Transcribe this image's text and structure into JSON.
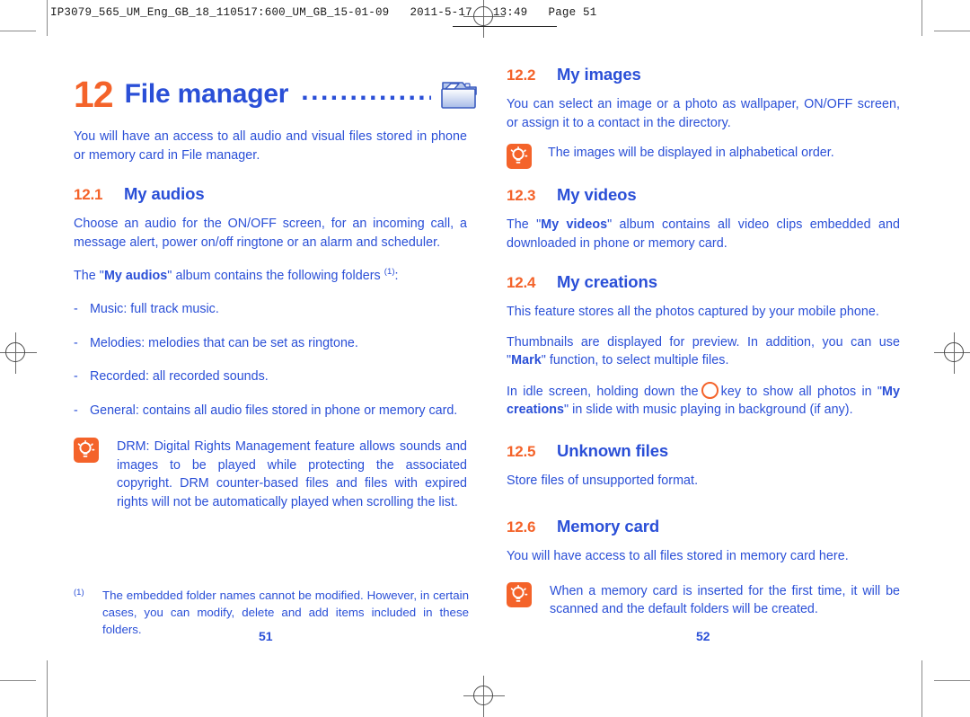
{
  "slug": {
    "text": "IP3079_565_UM_Eng_GB_18_110517:600_UM_GB_15-01-09   2011-5-17   13:49   Page 51"
  },
  "colors": {
    "heading_blue": "#2a4fd7",
    "accent_orange": "#f4632a",
    "body_blue": "#2a4fd7"
  },
  "chapter": {
    "number": "12",
    "name": "File manager",
    "dots": "................",
    "icon": "folder-icon"
  },
  "left_column": {
    "intro": "You will have an access to all audio and visual files stored in phone or memory card in File manager.",
    "sections": [
      {
        "number": "12.1",
        "title": "My audios",
        "paragraphs": [
          "Choose an audio for the ON/OFF screen, for an incoming call, a message alert, power on/off ringtone or an alarm and scheduler."
        ],
        "folders_intro_pre": "The \"",
        "folders_intro_bold": "My audios",
        "folders_intro_post": "\" album contains the following folders ",
        "folders_intro_sup": "(1)",
        "folders_intro_end": ":",
        "bullets": [
          {
            "dash": "-",
            "text": "Music: full track music."
          },
          {
            "dash": "-",
            "text": "Melodies: melodies that can be set as ringtone."
          },
          {
            "dash": "-",
            "text": "Recorded: all recorded sounds."
          },
          {
            "dash": "-",
            "text": "General: contains all audio files stored in phone or memory card."
          }
        ],
        "tip": {
          "icon": "tip-lightbulb-icon",
          "text": "DRM: Digital Rights Management feature allows sounds and images to be played while protecting the associated copyright. DRM counter-based files and files with expired rights will not be automatically played when scrolling the list."
        }
      }
    ]
  },
  "right_column": {
    "sections": [
      {
        "number": "12.2",
        "title": "My images",
        "paragraphs": [
          "You can select an image or a photo as wallpaper, ON/OFF screen, or assign it to a contact in the directory."
        ],
        "tip": {
          "icon": "tip-lightbulb-icon",
          "text": "The images will be displayed in alphabetical order."
        }
      },
      {
        "number": "12.3",
        "title": "My videos",
        "video_pre": "The \"",
        "video_bold": "My videos",
        "video_post": "\" album contains all video clips embedded and downloaded in phone or memory card."
      },
      {
        "number": "12.4",
        "title": "My creations",
        "p1": "This feature stores all the photos captured by your mobile phone.",
        "p2_pre": "Thumbnails are displayed for preview. In addition, you can use \"",
        "p2_bold": "Mark",
        "p2_post": "\" function, to select multiple files.",
        "p3_pre": "In idle screen, holding down the",
        "p3_key_icon": "round-key-icon",
        "p3_mid": "key to show all photos in \"",
        "p3_bold": "My creations",
        "p3_post": "\" in slide with music playing in background (if any)."
      },
      {
        "number": "12.5",
        "title": "Unknown files",
        "paragraphs": [
          "Store files of unsupported format."
        ]
      },
      {
        "number": "12.6",
        "title": "Memory card",
        "paragraphs": [
          "You will have access to all files stored in memory card here."
        ],
        "tip": {
          "icon": "tip-lightbulb-icon",
          "text": "When a memory card is inserted for the first time, it will be scanned and the default folders will be created."
        }
      }
    ]
  },
  "footnote": {
    "mark": "(1)",
    "text": "The embedded folder names cannot be modified. However, in certain cases, you can modify, delete and add items included in these folders."
  },
  "page_numbers": {
    "left": "51",
    "right": "52"
  }
}
